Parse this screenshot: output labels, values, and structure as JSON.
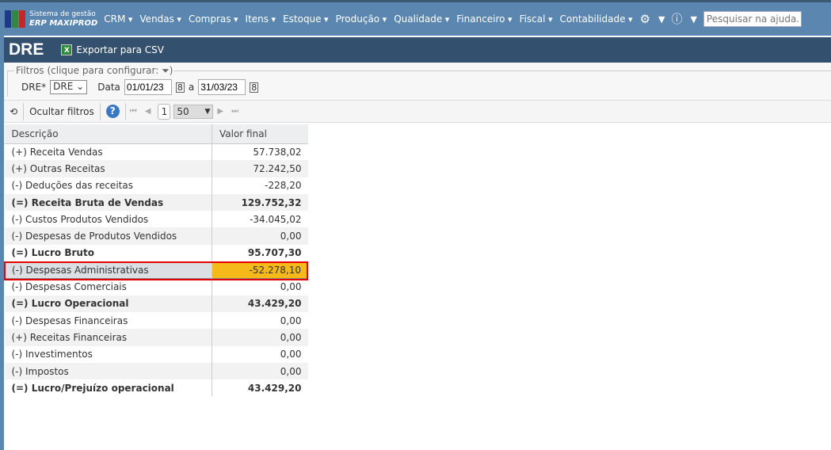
{
  "nav": {
    "logo_line1": "Sistema de gestão",
    "logo_line2": "ERP MAXIPROD",
    "menu": [
      "CRM",
      "Vendas",
      "Compras",
      "Itens",
      "Estoque",
      "Produção",
      "Qualidade",
      "Financeiro",
      "Fiscal",
      "Contabilidade"
    ],
    "search_placeholder": "Pesquisar na ajuda..."
  },
  "header": {
    "title": "DRE",
    "export_label": "Exportar para CSV"
  },
  "filters": {
    "legend": "Filtros (clique para configurar:",
    "legend_end": ")",
    "dre_label": "DRE*",
    "dre_value": "DRE",
    "data_label": "Data",
    "date_from": "01/01/23",
    "sep": "a",
    "date_to": "31/03/23"
  },
  "toolbar": {
    "hide_filters": "Ocultar filtros",
    "help": "?",
    "page": "1",
    "page_size": "50"
  },
  "table": {
    "headers": [
      "Descrição",
      "Valor final"
    ],
    "rows": [
      {
        "desc": "(+) Receita Vendas",
        "value": "57.738,02",
        "bold": false
      },
      {
        "desc": "(+) Outras Receitas",
        "value": "72.242,50",
        "bold": false
      },
      {
        "desc": "(-) Deduções das receitas",
        "value": "-228,20",
        "bold": false
      },
      {
        "desc": "(=) Receita Bruta de Vendas",
        "value": "129.752,32",
        "bold": true
      },
      {
        "desc": "(-) Custos Produtos Vendidos",
        "value": "-34.045,02",
        "bold": false
      },
      {
        "desc": "(-) Despesas de Produtos Vendidos",
        "value": "0,00",
        "bold": false
      },
      {
        "desc": "(=) Lucro Bruto",
        "value": "95.707,30",
        "bold": true
      },
      {
        "desc": "(-) Despesas Administrativas",
        "value": "-52.278,10",
        "bold": false,
        "selected": true
      },
      {
        "desc": "(-) Despesas Comerciais",
        "value": "0,00",
        "bold": false
      },
      {
        "desc": "(=) Lucro Operacional",
        "value": "43.429,20",
        "bold": true
      },
      {
        "desc": "(-) Despesas Financeiras",
        "value": "0,00",
        "bold": false
      },
      {
        "desc": "(+) Receitas Financeiras",
        "value": "0,00",
        "bold": false
      },
      {
        "desc": "(-) Investimentos",
        "value": "0,00",
        "bold": false
      },
      {
        "desc": "(-) Impostos",
        "value": "0,00",
        "bold": false
      },
      {
        "desc": "(=) Lucro/Prejuízo operacional",
        "value": "43.429,20",
        "bold": true
      }
    ]
  },
  "colors": {
    "nav": "#5a86b0",
    "header": "#34506f",
    "highlight": "#f5b91a",
    "outline": "#e60000"
  }
}
